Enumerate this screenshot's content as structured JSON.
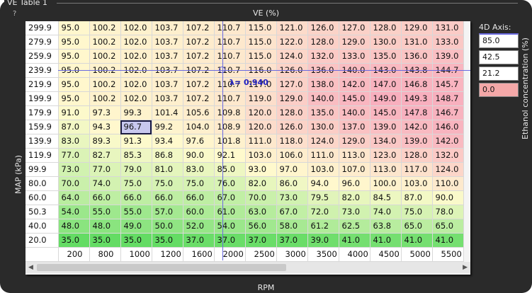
{
  "window": {
    "title": "VE Table 1",
    "help": "?"
  },
  "axes": {
    "x_title": "VE (%)",
    "y_title": "MAP (kPa)",
    "rpm_title": "RPM",
    "eth_title": "Ethanol concentration (%)"
  },
  "rpm": [
    200,
    800,
    1000,
    1200,
    1600,
    2000,
    2500,
    3000,
    3500,
    4000,
    4500,
    5000,
    5500
  ],
  "map": [
    "299.9",
    "279.9",
    "259.9",
    "239.9",
    "219.9",
    "199.9",
    "179.9",
    "159.9",
    "139.9",
    "119.9",
    "99.9",
    "80.0",
    "60.0",
    "50.3",
    "40.0",
    "20.0"
  ],
  "rows": [
    [
      "95.0",
      "100.2",
      "102.0",
      "103.7",
      "107.2",
      "110.7",
      "115.0",
      "121.0",
      "126.0",
      "127.0",
      "128.0",
      "129.0",
      "131.0"
    ],
    [
      "95.0",
      "100.2",
      "102.0",
      "103.7",
      "107.2",
      "110.7",
      "115.0",
      "122.0",
      "128.0",
      "129.0",
      "130.0",
      "131.0",
      "133.0"
    ],
    [
      "95.0",
      "100.2",
      "102.0",
      "103.7",
      "107.2",
      "110.7",
      "115.0",
      "124.0",
      "132.0",
      "133.0",
      "135.0",
      "136.0",
      "139.0"
    ],
    [
      "95.0",
      "100.2",
      "102.0",
      "103.7",
      "107.2",
      "110.7",
      "116.0",
      "126.0",
      "136.0",
      "140.0",
      "143.0",
      "143.8",
      "144.7"
    ],
    [
      "95.0",
      "100.2",
      "102.0",
      "103.7",
      "107.2",
      "110.7",
      "117.0",
      "127.0",
      "138.0",
      "142.0",
      "147.0",
      "146.8",
      "145.7"
    ],
    [
      "95.0",
      "100.2",
      "102.0",
      "103.7",
      "107.2",
      "110.7",
      "119.0",
      "129.0",
      "140.0",
      "145.0",
      "149.0",
      "149.3",
      "148.7"
    ],
    [
      "91.0",
      "97.3",
      "99.3",
      "101.4",
      "105.6",
      "109.8",
      "120.0",
      "128.0",
      "135.0",
      "140.0",
      "145.0",
      "147.8",
      "146.7"
    ],
    [
      "87.0",
      "94.3",
      "96.7",
      "99.2",
      "104.0",
      "108.9",
      "120.0",
      "126.0",
      "130.0",
      "137.0",
      "139.0",
      "142.0",
      "146.0"
    ],
    [
      "83.0",
      "89.3",
      "91.3",
      "93.4",
      "97.6",
      "101.8",
      "111.0",
      "118.0",
      "124.0",
      "129.0",
      "134.0",
      "139.0",
      "142.0"
    ],
    [
      "77.0",
      "82.7",
      "85.3",
      "86.8",
      "90.0",
      "92.1",
      "103.0",
      "106.0",
      "111.0",
      "113.0",
      "123.0",
      "128.0",
      "132.0"
    ],
    [
      "73.0",
      "77.0",
      "79.0",
      "81.0",
      "83.0",
      "85.0",
      "93.0",
      "97.0",
      "103.0",
      "107.0",
      "113.0",
      "117.0",
      "124.0"
    ],
    [
      "70.0",
      "74.0",
      "75.0",
      "75.0",
      "75.0",
      "76.0",
      "82.0",
      "86.0",
      "94.0",
      "96.0",
      "100.0",
      "103.0",
      "110.0"
    ],
    [
      "64.0",
      "66.0",
      "66.0",
      "66.0",
      "66.0",
      "67.0",
      "70.0",
      "73.0",
      "79.5",
      "82.0",
      "84.5",
      "87.0",
      "90.0"
    ],
    [
      "54.0",
      "55.0",
      "55.0",
      "57.0",
      "60.0",
      "61.0",
      "63.0",
      "67.0",
      "72.0",
      "73.0",
      "74.0",
      "75.0",
      "78.0"
    ],
    [
      "48.0",
      "48.0",
      "49.0",
      "50.0",
      "52.0",
      "54.0",
      "56.0",
      "58.0",
      "61.2",
      "62.5",
      "63.8",
      "65.0",
      "65.0"
    ],
    [
      "35.0",
      "35.0",
      "35.0",
      "35.0",
      "37.0",
      "37.0",
      "37.0",
      "37.0",
      "39.0",
      "41.0",
      "41.0",
      "41.0",
      "41.0"
    ]
  ],
  "selected": {
    "row": 7,
    "col": 2
  },
  "lambda_label": "λ= 0.940",
  "axis4d": {
    "label": "4D Axis:",
    "values": [
      "85.0",
      "42.5",
      "21.2",
      "0.0"
    ],
    "active_index": 3
  }
}
